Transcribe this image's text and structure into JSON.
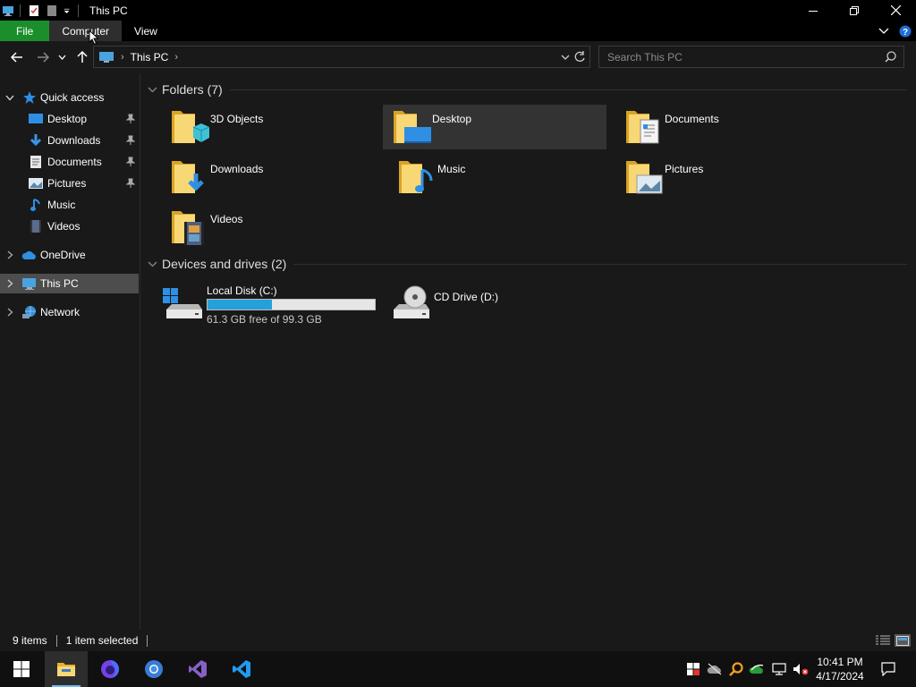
{
  "window": {
    "title": "This PC"
  },
  "ribbon": {
    "tabs": [
      {
        "label": "File"
      },
      {
        "label": "Computer"
      },
      {
        "label": "View"
      }
    ]
  },
  "address": {
    "crumbs": [
      "This PC"
    ]
  },
  "search": {
    "placeholder": "Search This PC",
    "value": ""
  },
  "nav": {
    "quick_access": "Quick access",
    "items": [
      {
        "label": "Desktop",
        "icon": "desktop-icon",
        "pinned": true
      },
      {
        "label": "Downloads",
        "icon": "downloads-icon",
        "pinned": true
      },
      {
        "label": "Documents",
        "icon": "documents-icon",
        "pinned": true
      },
      {
        "label": "Pictures",
        "icon": "pictures-icon",
        "pinned": true
      },
      {
        "label": "Music",
        "icon": "music-icon",
        "pinned": false
      },
      {
        "label": "Videos",
        "icon": "videos-icon",
        "pinned": false
      }
    ],
    "onedrive": "OneDrive",
    "this_pc": "This PC",
    "network": "Network"
  },
  "content": {
    "folders_header": "Folders (7)",
    "folders": [
      {
        "label": "3D Objects",
        "icon": "3d-objects-folder-icon",
        "selected": false
      },
      {
        "label": "Desktop",
        "icon": "desktop-folder-icon",
        "selected": true
      },
      {
        "label": "Documents",
        "icon": "documents-folder-icon",
        "selected": false
      },
      {
        "label": "Downloads",
        "icon": "downloads-folder-icon",
        "selected": false
      },
      {
        "label": "Music",
        "icon": "music-folder-icon",
        "selected": false
      },
      {
        "label": "Pictures",
        "icon": "pictures-folder-icon",
        "selected": false
      },
      {
        "label": "Videos",
        "icon": "videos-folder-icon",
        "selected": false
      }
    ],
    "drives_header": "Devices and drives (2)",
    "drives": [
      {
        "label": "Local Disk (C:)",
        "free_text": "61.3 GB free of 99.3 GB",
        "used_fraction": 0.383
      },
      {
        "label": "CD Drive (D:)"
      }
    ]
  },
  "status": {
    "count": "9 items",
    "selection": "1 item selected"
  },
  "taskbar": {
    "apps": [
      "start-icon",
      "file-explorer-icon",
      "firefox-icon",
      "chrome-icon",
      "visual-studio-icon",
      "vscode-icon"
    ],
    "clock_time": "10:41 PM",
    "clock_date": "4/17/2024"
  },
  "colors": {
    "accent": "#26a0da",
    "file_tab": "#1b8e2c",
    "folder": "#f5c542"
  }
}
